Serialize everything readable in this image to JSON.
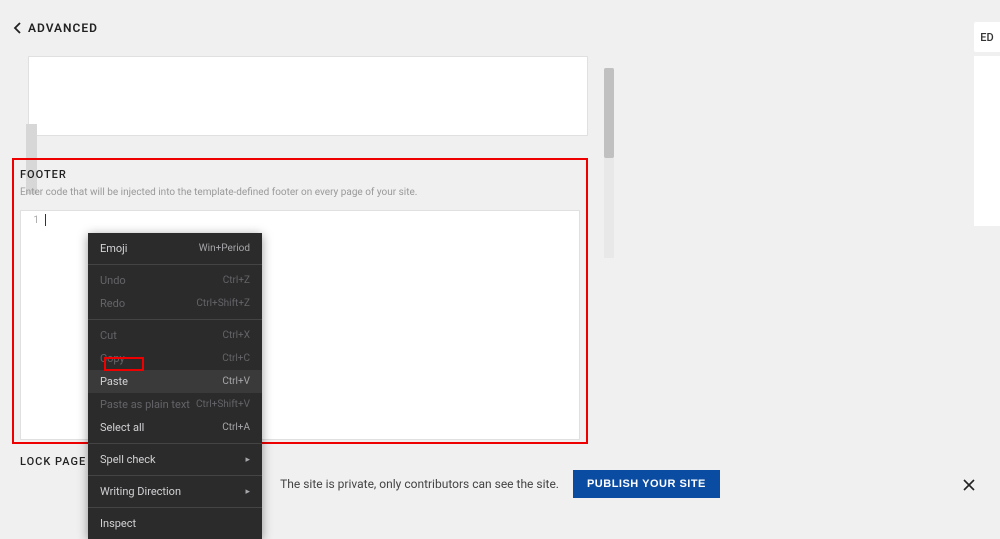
{
  "header": {
    "back_label": "ADVANCED"
  },
  "sidebar_tab": "ED",
  "footer": {
    "label": "FOOTER",
    "description": "Enter code that will be injected into the template-defined footer on every page of your site.",
    "line_number": "1"
  },
  "lock_page_label": "LOCK PAGE",
  "context_menu": {
    "items": [
      {
        "label": "Emoji",
        "shortcut": "Win+Period",
        "disabled": false,
        "arrow": false,
        "sep_after": true
      },
      {
        "label": "Undo",
        "shortcut": "Ctrl+Z",
        "disabled": true,
        "arrow": false,
        "sep_after": false
      },
      {
        "label": "Redo",
        "shortcut": "Ctrl+Shift+Z",
        "disabled": true,
        "arrow": false,
        "sep_after": true
      },
      {
        "label": "Cut",
        "shortcut": "Ctrl+X",
        "disabled": true,
        "arrow": false,
        "sep_after": false
      },
      {
        "label": "Copy",
        "shortcut": "Ctrl+C",
        "disabled": true,
        "arrow": false,
        "sep_after": false
      },
      {
        "label": "Paste",
        "shortcut": "Ctrl+V",
        "disabled": false,
        "arrow": false,
        "sep_after": false,
        "highlighted": true
      },
      {
        "label": "Paste as plain text",
        "shortcut": "Ctrl+Shift+V",
        "disabled": true,
        "arrow": false,
        "sep_after": false
      },
      {
        "label": "Select all",
        "shortcut": "Ctrl+A",
        "disabled": false,
        "arrow": false,
        "sep_after": true
      },
      {
        "label": "Spell check",
        "shortcut": "",
        "disabled": false,
        "arrow": true,
        "sep_after": true
      },
      {
        "label": "Writing Direction",
        "shortcut": "",
        "disabled": false,
        "arrow": true,
        "sep_after": true
      },
      {
        "label": "Inspect",
        "shortcut": "",
        "disabled": false,
        "arrow": false,
        "sep_after": false
      }
    ]
  },
  "bottom_bar": {
    "privacy_text": "The site is private, only contributors can see the site.",
    "publish_label": "PUBLISH YOUR SITE"
  }
}
